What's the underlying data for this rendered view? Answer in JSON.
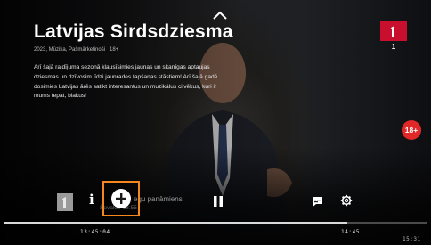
{
  "program": {
    "title": "Latvijas Sirdsdziesma",
    "meta": "2023, Mūzika, Pašmārketinoši",
    "age_note": "18+",
    "description": "Arī šajā raidījuma sezonā klausīsimies jaunas un skanīgas aptaujas dziesmas un dzīvosim līdzi jaunrades tapšanas stāstiem! Arī šajā gadē dosimies Latvijas ārēs satikt interesantus un muzikālus cilvēkus, kuri ir mums tepat, blakus!"
  },
  "channel": {
    "logo_text": "1",
    "number": "1",
    "brand_color": "#c8102e"
  },
  "age_rating": "18+",
  "controls": {
    "info_label": "i",
    "next_program_label": "egu panāmiens",
    "next_program_time": "Šovakar 18:55",
    "add_icon": "plus-circle-icon",
    "pause_icon": "pause-icon",
    "subtitles_icon": "subtitles-icon",
    "settings_icon": "gear-icon",
    "accent_color": "#f5871f"
  },
  "playback": {
    "start_time": "13:45:04",
    "end_time": "14:45",
    "clock": "15:31",
    "progress": 0.81
  }
}
